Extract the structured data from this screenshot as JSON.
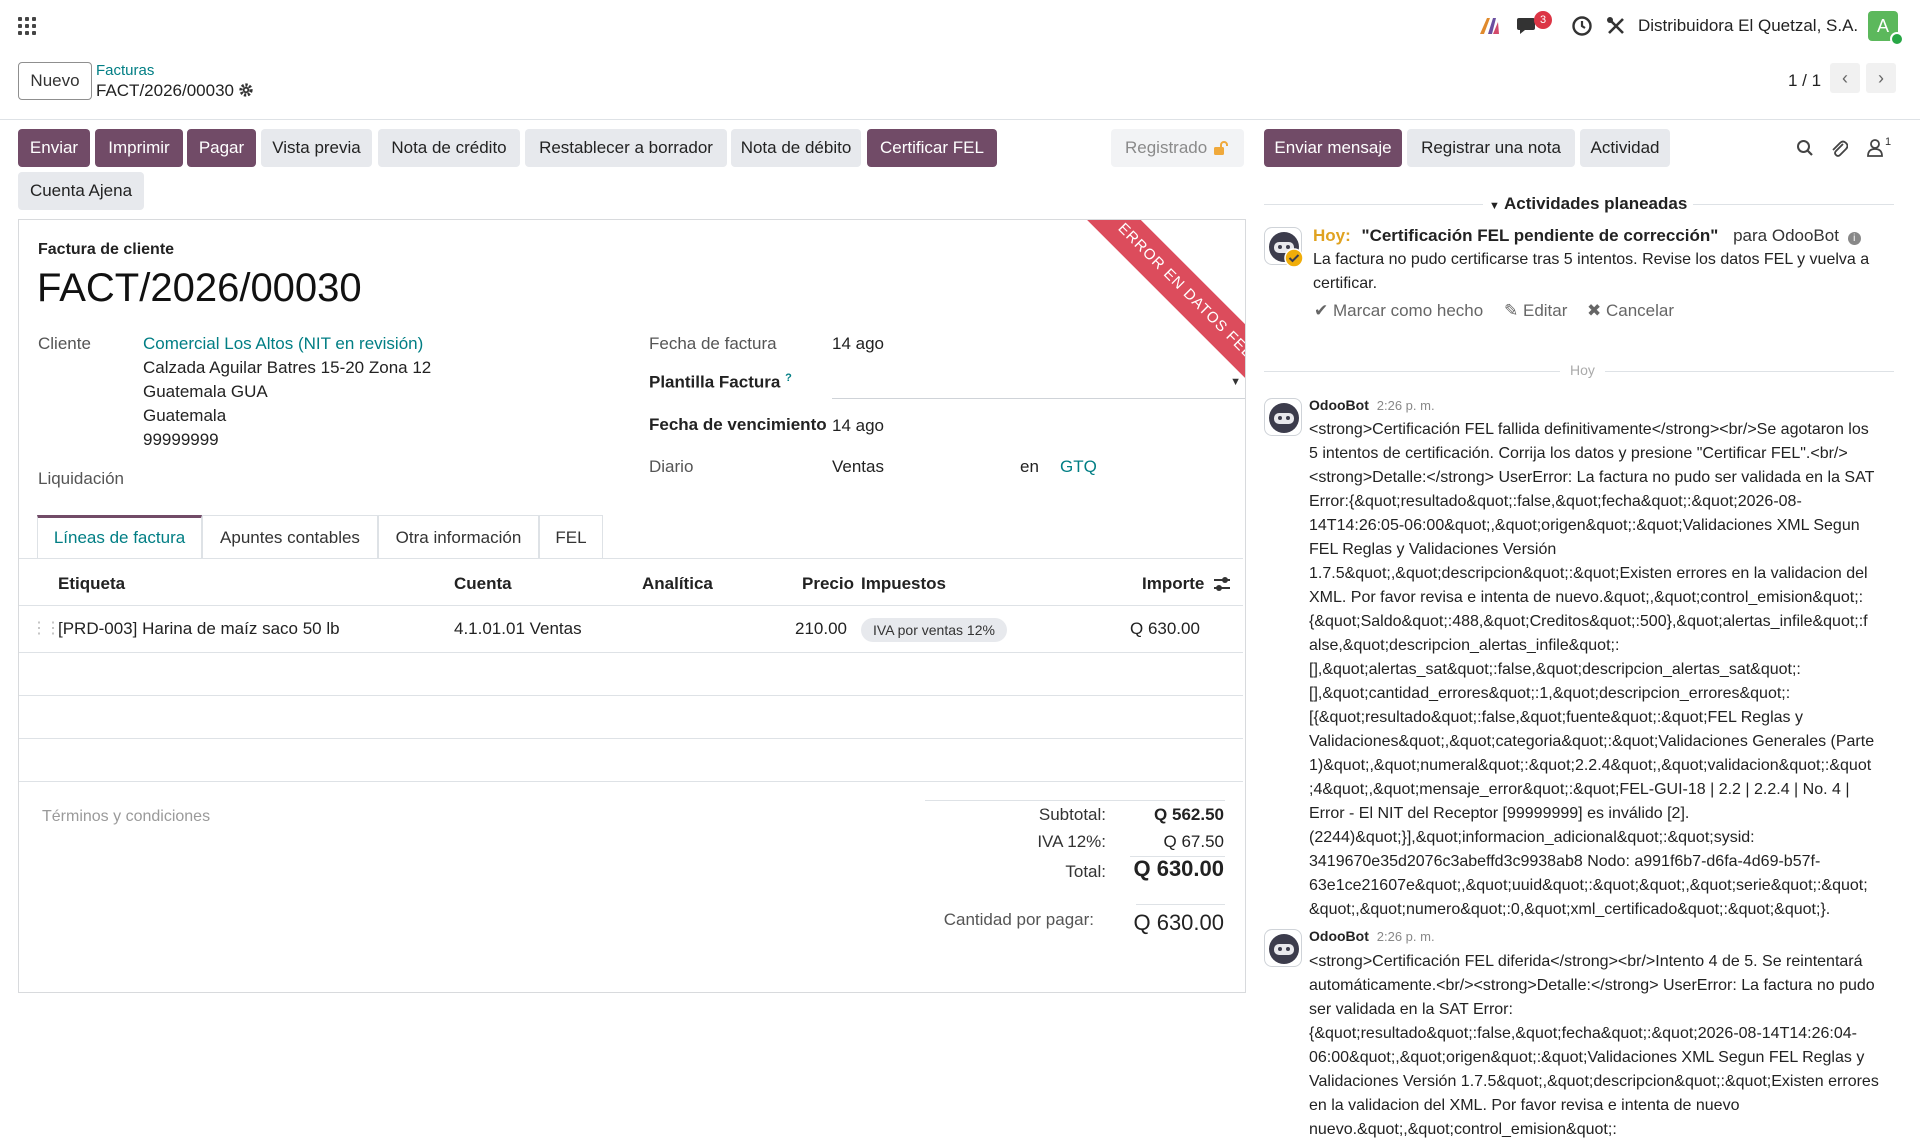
{
  "company": "Distribuidora El Quetzal, S.A.",
  "avatar_letter": "A",
  "messages_badge": "3",
  "breadcrumb": {
    "parent": "Facturas",
    "current": "FACT/2026/00030"
  },
  "new_button": "Nuevo",
  "pager": "1 / 1",
  "actions": {
    "enviar": "Enviar",
    "imprimir": "Imprimir",
    "pagar": "Pagar",
    "vista_previa": "Vista previa",
    "nota_credito": "Nota de crédito",
    "restablecer": "Restablecer a borrador",
    "nota_debito": "Nota de débito",
    "certificar": "Certificar FEL",
    "cuenta_ajena": "Cuenta Ajena",
    "status": "Registrado"
  },
  "ribbon": "ERROR EN DATOS FEL",
  "invoice": {
    "type_label": "Factura de cliente",
    "number": "FACT/2026/00030",
    "cliente_label": "Cliente",
    "cliente_name": "Comercial Los Altos (NIT en revisión)",
    "address": [
      "Calzada Aguilar Batres 15-20 Zona 12",
      "Guatemala GUA",
      "Guatemala",
      "99999999"
    ],
    "liquidacion_label": "Liquidación",
    "fecha_label": "Fecha de factura",
    "fecha_value": "14 ago",
    "plantilla_label": "Plantilla Factura",
    "plantilla_help": "?",
    "vencimiento_label": "Fecha de vencimiento",
    "vencimiento_value": "14 ago",
    "diario_label": "Diario",
    "diario_value": "Ventas",
    "en_label": "en",
    "currency": "GTQ"
  },
  "tabs": [
    "Líneas de factura",
    "Apuntes contables",
    "Otra información",
    "FEL"
  ],
  "table": {
    "headers": [
      "Etiqueta",
      "Cuenta",
      "Analítica",
      "Precio",
      "Impuestos",
      "Importe"
    ],
    "rows": [
      {
        "etiqueta": "[PRD-003] Harina de maíz saco 50 lb",
        "cuenta": "4.1.01.01 Ventas",
        "precio": "210.00",
        "impuesto": "IVA por ventas 12%",
        "importe": "Q 630.00"
      }
    ]
  },
  "terms_placeholder": "Términos y condiciones",
  "totals": {
    "subtotal_label": "Subtotal:",
    "subtotal": "Q 562.50",
    "iva_label": "IVA 12%:",
    "iva": "Q 67.50",
    "total_label": "Total:",
    "total": "Q 630.00",
    "due_label": "Cantidad por pagar:",
    "due": "Q 630.00"
  },
  "chatter": {
    "send_message": "Enviar mensaje",
    "log_note": "Registrar una nota",
    "activity": "Actividad",
    "followers_count": "1",
    "planned_title": "Actividades planeadas",
    "activity_today": "Hoy:",
    "activity_title": "\"Certificación FEL pendiente de corrección\"",
    "activity_for": "para OdooBot",
    "activity_note": "La factura no pudo certificarse tras 5 intentos. Revise los datos FEL y vuelva a certificar.",
    "mark_done": "Marcar como hecho",
    "edit": "Editar",
    "cancel": "Cancelar",
    "date_sep": "Hoy",
    "messages": [
      {
        "author": "OdooBot",
        "time": "2:26 p. m.",
        "lines": [
          "<strong>Certificación FEL fallida definitivamente</strong><br/>Se agotaron los",
          "5 intentos de certificación. Corrija los datos y presione \"Certificar FEL\".<br/>",
          "<strong>Detalle:</strong> UserError: La factura no pudo ser validada en la SAT",
          "Error:{&quot;resultado&quot;:false,&quot;fecha&quot;:&quot;2026-08-",
          "14T14:26:05-06:00&quot;,&quot;origen&quot;:&quot;Validaciones XML Segun",
          "FEL Reglas y Validaciones Versión",
          "1.7.5&quot;,&quot;descripcion&quot;:&quot;Existen errores en la validacion del",
          "XML. Por favor revisa e intenta de nuevo.&quot;,&quot;control_emision&quot;:",
          "{&quot;Saldo&quot;:488,&quot;Creditos&quot;:500},&quot;alertas_infile&quot;:f",
          "alse,&quot;descripcion_alertas_infile&quot;:",
          "[],&quot;alertas_sat&quot;:false,&quot;descripcion_alertas_sat&quot;:",
          "[],&quot;cantidad_errores&quot;:1,&quot;descripcion_errores&quot;:",
          "[{&quot;resultado&quot;:false,&quot;fuente&quot;:&quot;FEL Reglas y",
          "Validaciones&quot;,&quot;categoria&quot;:&quot;Validaciones Generales (Parte",
          "1)&quot;,&quot;numeral&quot;:&quot;2.2.4&quot;,&quot;validacion&quot;:&quot",
          ";4&quot;,&quot;mensaje_error&quot;:&quot;FEL-GUI-18 | 2.2 | 2.2.4 | No. 4 |",
          "Error - El NIT del Receptor [99999999] es inválido [2].",
          "(2244)&quot;}],&quot;informacion_adicional&quot;:&quot;sysid:",
          "3419670e35d2076c3abeffd3c9938ab8 Nodo: a991f6b7-d6fa-4d69-b57f-",
          "63e1ce21607e&quot;,&quot;uuid&quot;:&quot;&quot;,&quot;serie&quot;:&quot;",
          "&quot;,&quot;numero&quot;:0,&quot;xml_certificado&quot;:&quot;&quot;}."
        ]
      },
      {
        "author": "OdooBot",
        "time": "2:26 p. m.",
        "lines": [
          "<strong>Certificación FEL diferida</strong><br/>Intento 4 de 5. Se reintentará",
          "automáticamente.<br/><strong>Detalle:</strong> UserError: La factura no pudo",
          "ser validada en la SAT Error:",
          "{&quot;resultado&quot;:false,&quot;fecha&quot;:&quot;2026-08-14T14:26:04-",
          "06:00&quot;,&quot;origen&quot;:&quot;Validaciones XML Segun FEL Reglas y",
          "Validaciones Versión 1.7.5&quot;,&quot;descripcion&quot;:&quot;Existen errores",
          "en la validacion del XML. Por favor revisa e intenta de nuevo",
          "nuevo.&quot;,&quot;control_emision&quot;:"
        ]
      }
    ]
  }
}
